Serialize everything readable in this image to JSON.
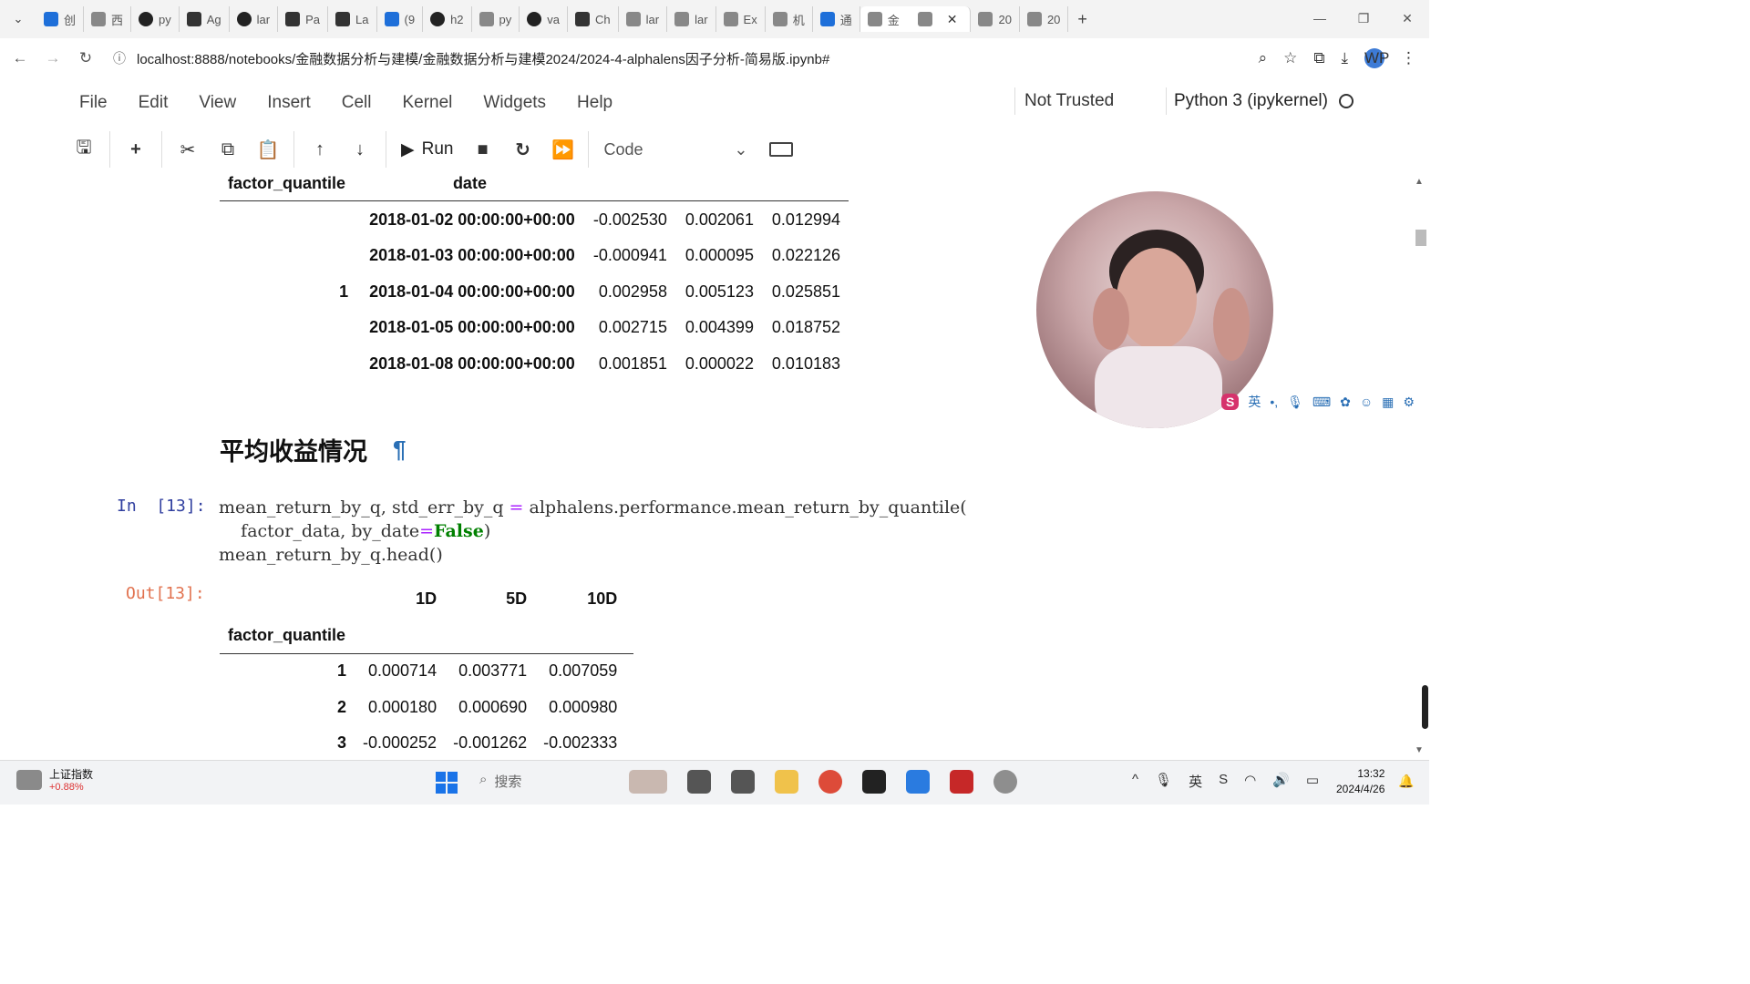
{
  "browser": {
    "tabs": [
      "创",
      "西",
      "py",
      "Ag",
      "lar",
      "Pa",
      "La",
      "(9",
      "h2",
      "py",
      "va",
      "Ch",
      "lar",
      "lar",
      "Ex",
      "机",
      "通",
      "金",
      "20",
      "20"
    ],
    "address": "localhost:8888/notebooks/金融数据分析与建模/金融数据分析与建模2024/2024-4-alphalens因子分析-简易版.ipynb#"
  },
  "jupyter": {
    "menu": [
      "File",
      "Edit",
      "View",
      "Insert",
      "Cell",
      "Kernel",
      "Widgets",
      "Help"
    ],
    "trusted": "Not Trusted",
    "kernel": "Python 3 (ipykernel)",
    "run_label": "Run",
    "cell_type": "Code"
  },
  "table1": {
    "index_names": [
      "factor_quantile",
      "date"
    ],
    "group_label": "1",
    "rows": [
      {
        "date": "2018-01-02 00:00:00+00:00",
        "v": [
          "-0.002530",
          "0.002061",
          "0.012994"
        ]
      },
      {
        "date": "2018-01-03 00:00:00+00:00",
        "v": [
          "-0.000941",
          "0.000095",
          "0.022126"
        ]
      },
      {
        "date": "2018-01-04 00:00:00+00:00",
        "v": [
          "0.002958",
          "0.005123",
          "0.025851"
        ]
      },
      {
        "date": "2018-01-05 00:00:00+00:00",
        "v": [
          "0.002715",
          "0.004399",
          "0.018752"
        ]
      },
      {
        "date": "2018-01-08 00:00:00+00:00",
        "v": [
          "0.001851",
          "0.000022",
          "0.010183"
        ]
      }
    ]
  },
  "markdown": {
    "heading": "平均收益情况",
    "pilcrow": "¶"
  },
  "cell13": {
    "in_prompt": "In  [13]:",
    "out_prompt": "Out[13]:",
    "code_line1_a": "mean_return_by_q, std_err_by_q ",
    "code_line1_eq": "=",
    "code_line1_b": " alphalens.performance.mean_return_by_quantile(",
    "code_line2_a": "    factor_data, by_date",
    "code_line2_eq": "=",
    "code_line2_kw": "False",
    "code_line2_b": ")",
    "code_line3": "mean_return_by_q.head()"
  },
  "table2": {
    "columns": [
      "1D",
      "5D",
      "10D"
    ],
    "index_name": "factor_quantile",
    "rows": [
      {
        "q": "1",
        "v": [
          "0.000714",
          "0.003771",
          "0.007059"
        ]
      },
      {
        "q": "2",
        "v": [
          "0.000180",
          "0.000690",
          "0.000980"
        ]
      },
      {
        "q": "3",
        "v": [
          "-0.000252",
          "-0.001262",
          "-0.002333"
        ]
      }
    ]
  },
  "ime": {
    "logo": "S",
    "mode": "英"
  },
  "taskbar": {
    "stock_name": "上证指数",
    "stock_change": "+0.88%",
    "search_placeholder": "搜索",
    "time": "13:32",
    "date": "2024/4/26"
  }
}
